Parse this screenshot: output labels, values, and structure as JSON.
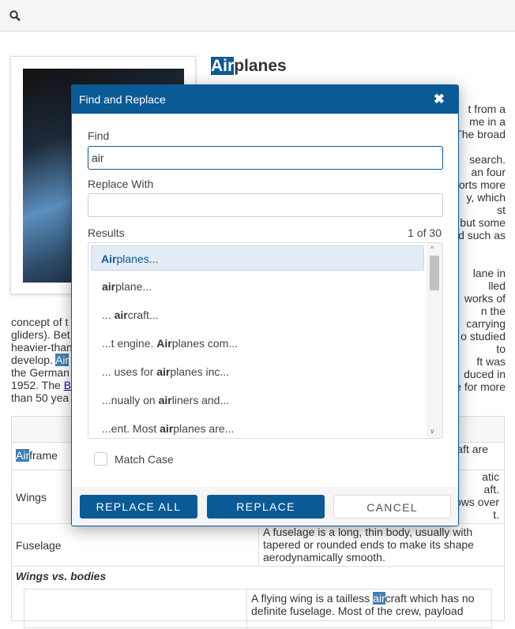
{
  "toolbar": {
    "icon": "search-icon"
  },
  "article": {
    "title_hl": "Air",
    "title_rest": "planes",
    "right_fragments": [
      "t from a",
      "me in a",
      "The broad",
      "",
      "search.",
      "an four",
      "orts more",
      "y, which",
      "st",
      "but some",
      "d such as",
      "",
      "",
      "lane in",
      "lled",
      "works of",
      "n the",
      "carrying",
      "o studied",
      "to",
      "ft was",
      "duced in",
      "e for more"
    ],
    "left_lines": [
      "concept of t",
      "gliders). Bet",
      "heavier-than",
      "develop. ",
      "the German",
      "1952. The ",
      "than 50 yea"
    ],
    "left_hl": "Air",
    "left_link": "B"
  },
  "table": {
    "rows": [
      {
        "label_hl": "Air",
        "label_rest": "frame",
        "desc": "aft are"
      },
      {
        "label": "Wings",
        "desc": "atic\naft.\nows over\nt."
      },
      {
        "label": "Fuselage",
        "desc": "A fuselage is a long, thin body, usually with\ntapered or rounded ends to make its shape\naerodynamically smooth."
      }
    ],
    "section": "Wings vs. bodies",
    "nested_desc_pre": "A flying wing is a tailless ",
    "nested_desc_hl": "air",
    "nested_desc_post": "craft which has no",
    "nested_desc_line2": "definite fuselage. Most of the crew, payload"
  },
  "dialog": {
    "title": "Find and Replace",
    "close_icon": "close-icon",
    "find_label": "Find",
    "find_value": "air",
    "replace_label": "Replace With",
    "replace_value": "",
    "results_label": "Results",
    "results_count": "1 of 30",
    "results": [
      {
        "pre": "",
        "match": "Air",
        "post": "planes..."
      },
      {
        "pre": "",
        "match": "air",
        "post": "plane..."
      },
      {
        "pre": "... ",
        "match": "air",
        "post": "craft..."
      },
      {
        "pre": "...t engine. ",
        "match": "Air",
        "post": "planes com..."
      },
      {
        "pre": "... uses for ",
        "match": "air",
        "post": "planes inc..."
      },
      {
        "pre": "...nually on ",
        "match": "air",
        "post": "liners and..."
      },
      {
        "pre": "...ent. Most ",
        "match": "air",
        "post": "planes are..."
      }
    ],
    "match_case_label": "Match Case",
    "match_case_checked": false,
    "replace_all": "REPLACE ALL",
    "replace": "REPLACE",
    "cancel": "CANCEL",
    "accent": "#0a5a96"
  }
}
